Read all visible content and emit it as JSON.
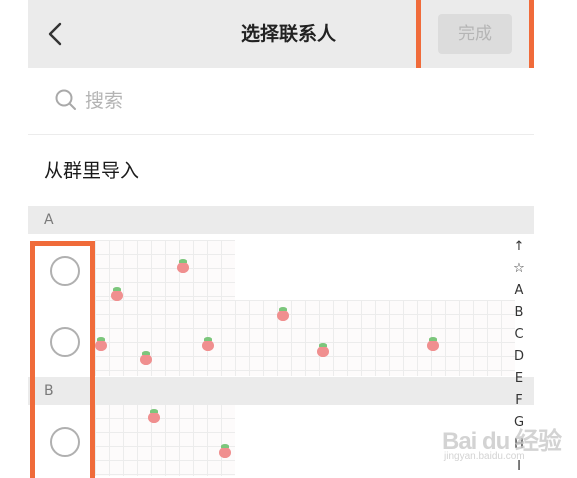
{
  "header": {
    "back_icon": "chevron-left-icon",
    "title": "选择联系人",
    "done_label": "完成"
  },
  "search": {
    "icon": "search-icon",
    "placeholder": "搜索"
  },
  "import": {
    "label": "从群里导入"
  },
  "sections": [
    {
      "letter": "A"
    },
    {
      "letter": "B"
    }
  ],
  "index_bar": [
    "↑",
    "☆",
    "A",
    "B",
    "C",
    "D",
    "E",
    "F",
    "G",
    "H",
    "I"
  ],
  "watermark": {
    "main": "Bai du 经验",
    "sub": "jingyan.baidu.com"
  },
  "colors": {
    "highlight": "#f06b3a",
    "header_bg": "#ebebeb",
    "done_disabled": "#b5b5b5"
  }
}
